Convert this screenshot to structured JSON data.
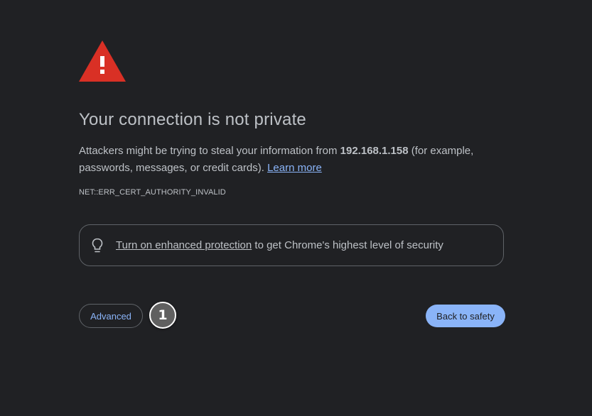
{
  "colors": {
    "background": "#202124",
    "text": "#bdc1c6",
    "accent": "#8ab4f8",
    "warning": "#d93025"
  },
  "icons": {
    "warning": "warning-triangle-icon",
    "bulb": "lightbulb-icon"
  },
  "heading": {
    "title": "Your connection is not private"
  },
  "description": {
    "prefix": "Attackers might be trying to steal your information from ",
    "host": "192.168.1.158",
    "suffix": " (for example, passwords, messages, or credit cards). ",
    "learn_more": "Learn more"
  },
  "error_code": "NET::ERR_CERT_AUTHORITY_INVALID",
  "protection": {
    "link_text": "Turn on enhanced protection",
    "rest_text": " to get Chrome's highest level of security"
  },
  "buttons": {
    "advanced": "Advanced",
    "back_to_safety": "Back to safety"
  },
  "annotation_marker": "1"
}
